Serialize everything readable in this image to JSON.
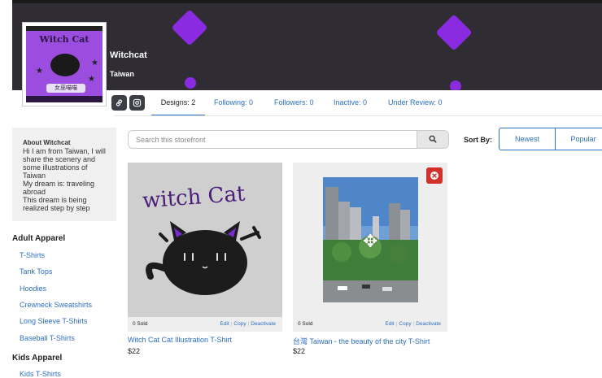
{
  "store": {
    "name": "Witchcat",
    "location": "Taiwan",
    "avatar_title": "Witch Cat",
    "avatar_subtitle": "女巫喵喵"
  },
  "colors": {
    "accent": "#2e6fbf",
    "banner": "#2f2d33",
    "brand_purple": "#8a2be2",
    "danger": "#d0312d"
  },
  "social": [
    {
      "icon": "link-icon"
    },
    {
      "icon": "instagram-icon"
    }
  ],
  "tabs": [
    {
      "label": "Designs: 2",
      "active": true
    },
    {
      "label": "Following: 0"
    },
    {
      "label": "Followers: 0"
    },
    {
      "label": "Inactive: 0"
    },
    {
      "label": "Under Review: 0"
    }
  ],
  "about": {
    "title": "About Witchcat",
    "lines": [
      "Hi I am from Taiwan, I will share the scenery and some illustrations of Taiwan",
      "My dream is: traveling abroad",
      "This dream is being realized step by step"
    ]
  },
  "sidebar": {
    "adult_heading": "Adult Apparel",
    "adult_items": [
      "T-Shirts",
      "Tank Tops",
      "Hoodies",
      "Crewneck Sweatshirts",
      "Long Sleeve T-Shirts",
      "Baseball T-Shirts"
    ],
    "kids_heading": "Kids Apparel",
    "kids_items": [
      "Kids T-Shirts"
    ]
  },
  "search": {
    "placeholder": "Search this storefront",
    "icon": "search-icon"
  },
  "sort": {
    "label": "Sort By:",
    "options": [
      "Newest",
      "Popular"
    ]
  },
  "products": [
    {
      "image_text": "witch Cat",
      "sold": "0 Sold",
      "actions": [
        "Edit",
        "Copy",
        "Deactivate"
      ],
      "title": "Witch Cat Cat Illustration T-Shirt",
      "price": "$22"
    },
    {
      "sold": "0 Sold",
      "actions": [
        "Edit",
        "Copy",
        "Deactivate"
      ],
      "title": "台灣 Taiwan - the beauty of the city T-Shirt",
      "price": "$22"
    }
  ]
}
